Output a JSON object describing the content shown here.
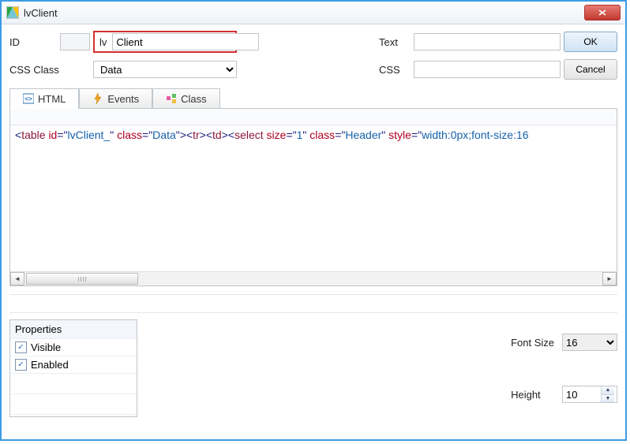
{
  "window": {
    "title": "lvClient"
  },
  "form": {
    "id_label": "ID",
    "lv_label": "lv",
    "id_value": "Client",
    "text_label": "Text",
    "text_value": "",
    "css_class_label": "CSS Class",
    "css_class_value": "Data",
    "css_label": "CSS",
    "css_value": ""
  },
  "buttons": {
    "ok": "OK",
    "cancel": "Cancel"
  },
  "tabs": {
    "html": "HTML",
    "events": "Events",
    "class": "Class"
  },
  "code": {
    "tokens": [
      {
        "t": "punct",
        "v": "<"
      },
      {
        "t": "tag",
        "v": "table"
      },
      {
        "t": "_",
        "v": " "
      },
      {
        "t": "attr",
        "v": "id"
      },
      {
        "t": "eq",
        "v": "="
      },
      {
        "t": "punct",
        "v": "\""
      },
      {
        "t": "val",
        "v": "lvClient_"
      },
      {
        "t": "punct",
        "v": "\""
      },
      {
        "t": "_",
        "v": " "
      },
      {
        "t": "attr",
        "v": "class"
      },
      {
        "t": "eq",
        "v": "="
      },
      {
        "t": "punct",
        "v": "\""
      },
      {
        "t": "val",
        "v": "Data"
      },
      {
        "t": "punct",
        "v": "\""
      },
      {
        "t": "punct",
        "v": "><"
      },
      {
        "t": "tag",
        "v": "tr"
      },
      {
        "t": "punct",
        "v": "><"
      },
      {
        "t": "tag",
        "v": "td"
      },
      {
        "t": "punct",
        "v": "><"
      },
      {
        "t": "tag",
        "v": "select"
      },
      {
        "t": "_",
        "v": " "
      },
      {
        "t": "attr",
        "v": "size"
      },
      {
        "t": "eq",
        "v": "="
      },
      {
        "t": "punct",
        "v": "\""
      },
      {
        "t": "val",
        "v": "1"
      },
      {
        "t": "punct",
        "v": "\""
      },
      {
        "t": "_",
        "v": " "
      },
      {
        "t": "attr",
        "v": "class"
      },
      {
        "t": "eq",
        "v": "="
      },
      {
        "t": "punct",
        "v": "\""
      },
      {
        "t": "val",
        "v": "Header"
      },
      {
        "t": "punct",
        "v": "\""
      },
      {
        "t": "_",
        "v": " "
      },
      {
        "t": "attr",
        "v": "style"
      },
      {
        "t": "eq",
        "v": "="
      },
      {
        "t": "punct",
        "v": "\""
      },
      {
        "t": "val",
        "v": "width:0px;font-size:16"
      }
    ]
  },
  "properties": {
    "heading": "Properties",
    "visible_label": "Visible",
    "visible_checked": true,
    "enabled_label": "Enabled",
    "enabled_checked": true
  },
  "options": {
    "font_size_label": "Font Size",
    "font_size_value": "16",
    "height_label": "Height",
    "height_value": "10"
  }
}
